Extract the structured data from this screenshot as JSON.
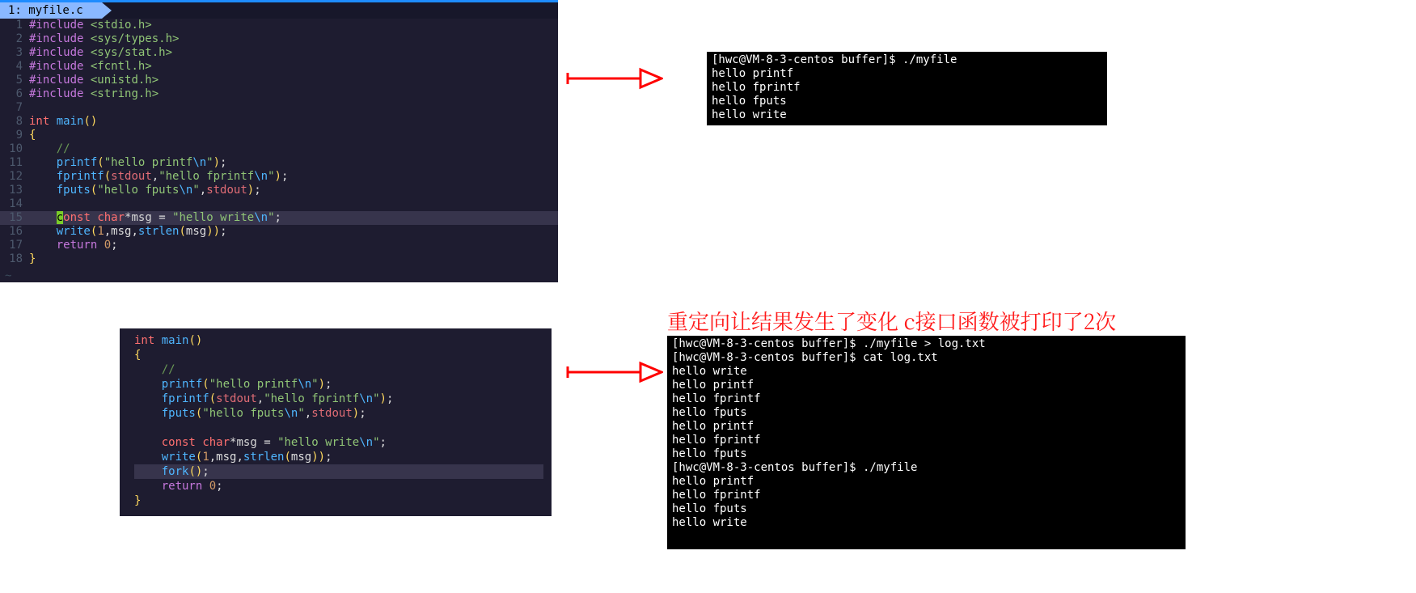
{
  "editor1": {
    "tab_label": "1: myfile.c",
    "lines": [
      {
        "n": "1",
        "html": "<span class='kw-pp'>#include</span> <span class='str'>&lt;stdio.h&gt;</span>"
      },
      {
        "n": "2",
        "html": "<span class='kw-pp'>#include</span> <span class='str'>&lt;sys/types.h&gt;</span>"
      },
      {
        "n": "3",
        "html": "<span class='kw-pp'>#include</span> <span class='str'>&lt;sys/stat.h&gt;</span>"
      },
      {
        "n": "4",
        "html": "<span class='kw-pp'>#include</span> <span class='str'>&lt;fcntl.h&gt;</span>"
      },
      {
        "n": "5",
        "html": "<span class='kw-pp'>#include</span> <span class='str'>&lt;unistd.h&gt;</span>"
      },
      {
        "n": "6",
        "html": "<span class='kw-pp'>#include</span> <span class='str'>&lt;string.h&gt;</span>"
      },
      {
        "n": "7",
        "html": ""
      },
      {
        "n": "8",
        "html": "<span class='kw-type'>int</span> <span class='fn'>main</span><span class='br'>()</span>"
      },
      {
        "n": "9",
        "html": "<span class='br'>{</span>"
      },
      {
        "n": "10",
        "html": "    <span class='comm'>//</span>"
      },
      {
        "n": "11",
        "html": "    <span class='fn'>printf</span><span class='br'>(</span><span class='str'>\"hello printf</span><span class='strnl'>\\n</span><span class='str'>\"</span><span class='br'>)</span>;"
      },
      {
        "n": "12",
        "html": "    <span class='fn'>fprintf</span><span class='br'>(</span><span class='ident'>stdout</span>,<span class='str'>\"hello fprintf</span><span class='strnl'>\\n</span><span class='str'>\"</span><span class='br'>)</span>;"
      },
      {
        "n": "13",
        "html": "    <span class='fn'>fputs</span><span class='br'>(</span><span class='str'>\"hello fputs</span><span class='strnl'>\\n</span><span class='str'>\"</span>,<span class='ident'>stdout</span><span class='br'>)</span>;"
      },
      {
        "n": "14",
        "html": ""
      },
      {
        "n": "15",
        "html": "    <span class='cursor'>c</span><span class='kw-type'>onst</span> <span class='kw-type'>char</span>*<span class='ident2'>msg</span> = <span class='str'>\"hello write</span><span class='strnl'>\\n</span><span class='str'>\"</span>;",
        "hl": true
      },
      {
        "n": "16",
        "html": "    <span class='fn'>write</span><span class='br'>(</span><span class='num'>1</span>,msg,<span class='fn'>strlen</span><span class='br'>(</span>msg<span class='br'>))</span>;"
      },
      {
        "n": "17",
        "html": "    <span class='kw-ret'>return</span> <span class='num'>0</span>;"
      },
      {
        "n": "18",
        "html": "<span class='br'>}</span>"
      }
    ]
  },
  "terminal1": {
    "lines": [
      "[hwc@VM-8-3-centos buffer]$ ./myfile",
      "hello printf",
      "hello fprintf",
      "hello fputs",
      "hello write"
    ]
  },
  "annotation": "重定向让结果发生了变化 c接口函数被打印了2次",
  "editor2": {
    "lines": [
      {
        "html": "<span class='kw-type'>int</span> <span class='fn'>main</span><span class='br'>()</span>"
      },
      {
        "html": "<span class='br'>{</span>"
      },
      {
        "html": "    <span class='comm'>//</span>"
      },
      {
        "html": "    <span class='fn'>printf</span><span class='br'>(</span><span class='str'>\"hello printf</span><span class='strnl'>\\n</span><span class='str'>\"</span><span class='br'>)</span>;"
      },
      {
        "html": "    <span class='fn'>fprintf</span><span class='br'>(</span><span class='ident'>stdout</span>,<span class='str'>\"hello fprintf</span><span class='strnl'>\\n</span><span class='str'>\"</span><span class='br'>)</span>;"
      },
      {
        "html": "    <span class='fn'>fputs</span><span class='br'>(</span><span class='str'>\"hello fputs</span><span class='strnl'>\\n</span><span class='str'>\"</span>,<span class='ident'>stdout</span><span class='br'>)</span>;"
      },
      {
        "html": ""
      },
      {
        "html": "    <span class='kw-type'>const</span> <span class='kw-type'>char</span>*<span class='ident2'>msg</span> = <span class='str'>\"hello write</span><span class='strnl'>\\n</span><span class='str'>\"</span>;"
      },
      {
        "html": "    <span class='fn'>write</span><span class='br'>(</span><span class='num'>1</span>,msg,<span class='fn'>strlen</span><span class='br'>(</span>msg<span class='br'>))</span>;"
      },
      {
        "html": "    <span class='fn'>fork</span><span class='br'>()</span>;",
        "hl": true
      },
      {
        "html": "    <span class='kw-ret'>return</span> <span class='num'>0</span>;"
      },
      {
        "html": "<span class='br'>}</span>"
      }
    ]
  },
  "terminal2": {
    "lines": [
      "[hwc@VM-8-3-centos buffer]$ ./myfile > log.txt",
      "[hwc@VM-8-3-centos buffer]$ cat log.txt",
      "hello write",
      "hello printf",
      "hello fprintf",
      "hello fputs",
      "hello printf",
      "hello fprintf",
      "hello fputs",
      "[hwc@VM-8-3-centos buffer]$ ./myfile",
      "hello printf",
      "hello fprintf",
      "hello fputs",
      "hello write"
    ]
  }
}
